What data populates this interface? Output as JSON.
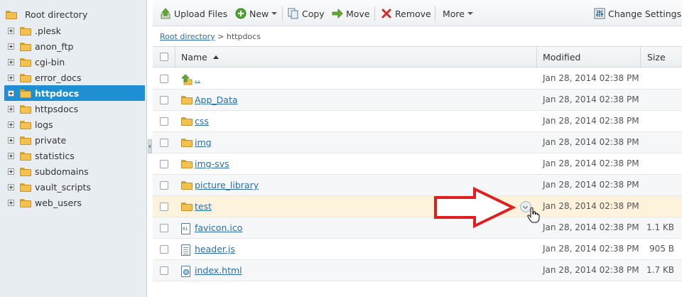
{
  "sidebar": {
    "root_label": "Root directory",
    "items": [
      {
        "label": ".plesk",
        "selected": false
      },
      {
        "label": "anon_ftp",
        "selected": false
      },
      {
        "label": "cgi-bin",
        "selected": false
      },
      {
        "label": "error_docs",
        "selected": false
      },
      {
        "label": "httpdocs",
        "selected": true
      },
      {
        "label": "httpsdocs",
        "selected": false
      },
      {
        "label": "logs",
        "selected": false
      },
      {
        "label": "private",
        "selected": false
      },
      {
        "label": "statistics",
        "selected": false
      },
      {
        "label": "subdomains",
        "selected": false
      },
      {
        "label": "vault_scripts",
        "selected": false
      },
      {
        "label": "web_users",
        "selected": false
      }
    ]
  },
  "toolbar": {
    "upload_label": "Upload Files",
    "new_label": "New",
    "copy_label": "Copy",
    "move_label": "Move",
    "remove_label": "Remove",
    "more_label": "More",
    "settings_label": "Change Settings"
  },
  "breadcrumb": {
    "root": "Root directory",
    "separator": ">",
    "current": "httpdocs"
  },
  "table": {
    "columns": {
      "name": "Name",
      "modified": "Modified",
      "size": "Size"
    },
    "rows": [
      {
        "name": "..",
        "type": "up",
        "modified": "Jan 28, 2014 02:38 PM",
        "size": ""
      },
      {
        "name": "App_Data",
        "type": "folder",
        "modified": "Jan 28, 2014 02:38 PM",
        "size": ""
      },
      {
        "name": "css",
        "type": "folder",
        "modified": "Jan 28, 2014 02:38 PM",
        "size": ""
      },
      {
        "name": "img",
        "type": "folder",
        "modified": "Jan 28, 2014 02:38 PM",
        "size": ""
      },
      {
        "name": "img-svs",
        "type": "folder",
        "modified": "Jan 28, 2014 02:38 PM",
        "size": ""
      },
      {
        "name": "picture_library",
        "type": "folder",
        "modified": "Jan 28, 2014 02:38 PM",
        "size": ""
      },
      {
        "name": "test",
        "type": "folder",
        "modified": "Jan 28, 2014 02:38 PM",
        "size": ""
      },
      {
        "name": "favicon.ico",
        "type": "ico",
        "modified": "Jan 28, 2014 02:38 PM",
        "size": "1.1 KB"
      },
      {
        "name": "header.js",
        "type": "script",
        "modified": "Jan 28, 2014 02:38 PM",
        "size": "905 B"
      },
      {
        "name": "index.html",
        "type": "html",
        "modified": "Jan 28, 2014 02:38 PM",
        "size": "1.7 KB"
      }
    ]
  },
  "colors": {
    "selected_bg": "#1f8fd4",
    "highlight_row": "#fdf3dc",
    "link": "#2a6ea8",
    "annotation_arrow": "#e02020"
  }
}
